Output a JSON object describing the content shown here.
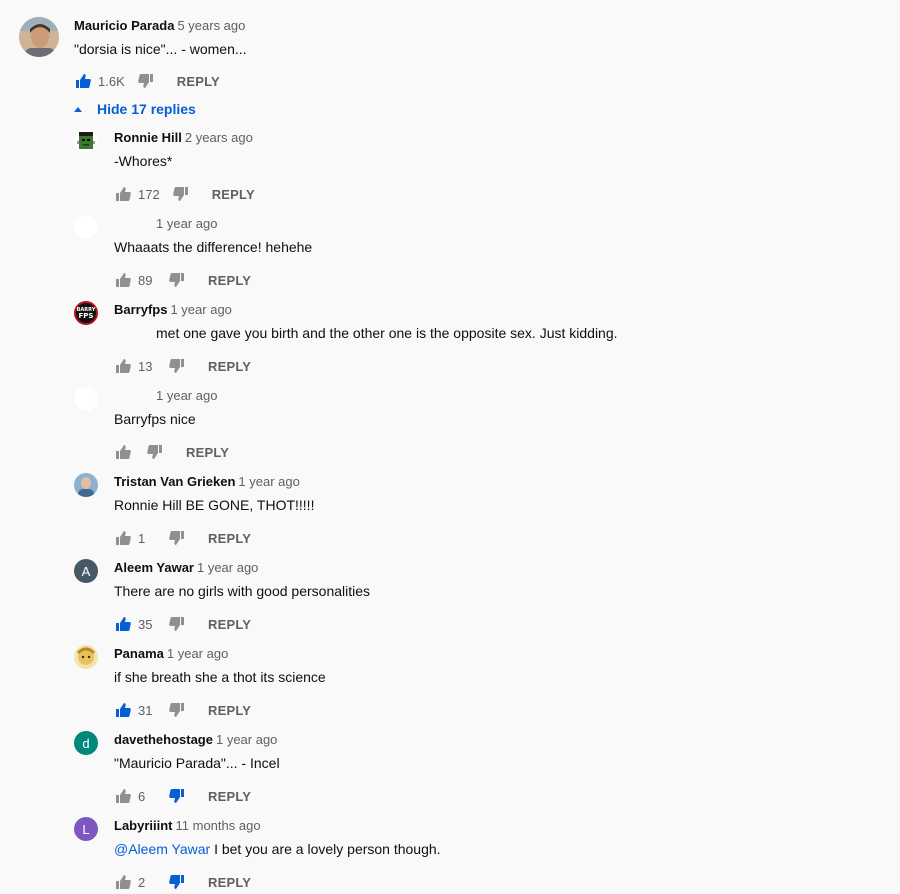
{
  "top_comment": {
    "author": "Mauricio Parada",
    "time": "5 years ago",
    "text": "\"dorsia is nice\"... - women...",
    "likes": "1.6K",
    "liked": true,
    "disliked": false,
    "reply_label": "REPLY"
  },
  "hide_replies_label": "Hide 17 replies",
  "replies": [
    {
      "author": "Ronnie Hill",
      "time": "2 years ago",
      "text": "-Whores*",
      "mention": "",
      "likes": "172",
      "liked": false,
      "disliked": false,
      "reply_label": "REPLY",
      "avatar": "frankenstein",
      "avatar_color": "#3a7a2e",
      "avatar_letter": ""
    },
    {
      "author": "",
      "time": "1 year ago",
      "text": "Whaaats the difference! hehehe",
      "mention": "",
      "likes": "89",
      "liked": false,
      "disliked": false,
      "reply_label": "REPLY",
      "avatar": "blank",
      "avatar_color": "#ffffff",
      "avatar_letter": ""
    },
    {
      "author": "Barryfps",
      "time": "1 year ago",
      "text": "met one gave you birth and the other one is the opposite sex. Just kidding.",
      "mention": "",
      "likes": "13",
      "liked": false,
      "disliked": false,
      "reply_label": "REPLY",
      "avatar": "barryfps",
      "avatar_color": "#111111",
      "avatar_letter": ""
    },
    {
      "author": "",
      "time": "1 year ago",
      "text": "Barryfps nice",
      "mention": "",
      "likes": "",
      "liked": false,
      "disliked": false,
      "reply_label": "REPLY",
      "avatar": "blank",
      "avatar_color": "#ffffff",
      "avatar_letter": ""
    },
    {
      "author": "Tristan Van Grieken",
      "time": "1 year ago",
      "text": "Ronnie Hill BE GONE, THOT!!!!!",
      "mention": "",
      "likes": "1",
      "liked": false,
      "disliked": false,
      "reply_label": "REPLY",
      "avatar": "photo",
      "avatar_color": "#6c8fb3",
      "avatar_letter": ""
    },
    {
      "author": "Aleem Yawar",
      "time": "1 year ago",
      "text": "There are no girls with good personalities",
      "mention": "",
      "likes": "35",
      "liked": true,
      "disliked": false,
      "reply_label": "REPLY",
      "avatar": "letter",
      "avatar_color": "#455a64",
      "avatar_letter": "A"
    },
    {
      "author": "Panama",
      "time": "1 year ago",
      "text": "if she breath she a thot its science",
      "mention": "",
      "likes": "31",
      "liked": true,
      "disliked": false,
      "reply_label": "REPLY",
      "avatar": "panama",
      "avatar_color": "#e8c25a",
      "avatar_letter": ""
    },
    {
      "author": "davethehostage",
      "time": "1 year ago",
      "text": "\"Mauricio Parada\"... - Incel",
      "mention": "",
      "likes": "6",
      "liked": false,
      "disliked": true,
      "reply_label": "REPLY",
      "avatar": "letter",
      "avatar_color": "#00897b",
      "avatar_letter": "d"
    },
    {
      "author": "Labyriiint",
      "time": "11 months ago",
      "text": " I bet you are a lovely person though.",
      "mention": "@Aleem Yawar",
      "likes": "2",
      "liked": false,
      "disliked": true,
      "reply_label": "REPLY",
      "avatar": "letter",
      "avatar_color": "#7e57c2",
      "avatar_letter": "L"
    }
  ],
  "colors": {
    "accent": "#065fd4",
    "muted": "#606060",
    "icon_inactive": "#909090"
  }
}
